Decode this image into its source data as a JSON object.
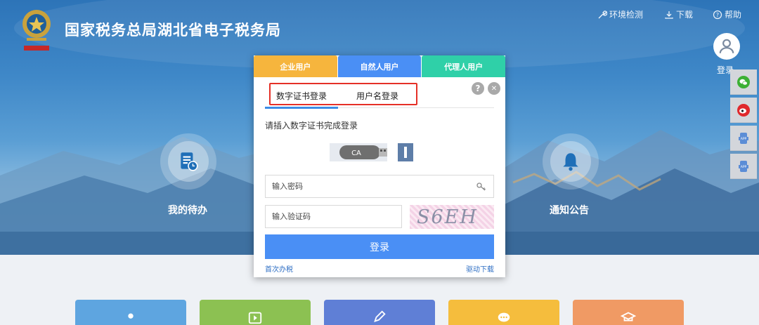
{
  "header": {
    "site_title": "国家税务总局湖北省电子税务局",
    "env_check": "环境检测",
    "download": "下载",
    "help": "帮助",
    "login": "登录"
  },
  "features": {
    "todo": "我的待办",
    "notice": "通知公告"
  },
  "dialog": {
    "user_tabs": [
      {
        "label": "企业用户",
        "color": "#f6b53d"
      },
      {
        "label": "自然人用户",
        "color": "#4a8ff5"
      },
      {
        "label": "代理人用户",
        "color": "#2fd0a8"
      }
    ],
    "login_tabs": {
      "cert": "数字证书登录",
      "username": "用户名登录"
    },
    "help_icon": "?",
    "close_icon": "✕",
    "hint": "请插入数字证书完成登录",
    "ca_label": "CA",
    "password_placeholder": "输入密码",
    "captcha_placeholder": "输入验证码",
    "captcha_text": "S6EH",
    "login_button": "登录",
    "first_time": "首次办税",
    "driver_download": "驱动下载"
  },
  "side_dock": [
    "wechat-icon",
    "weibo-icon",
    "app-icon",
    "app-icon"
  ],
  "colors": {
    "accent": "#4a8ff5",
    "highlight": "#e53027",
    "tile_colors": [
      "#5ea5e0",
      "#8cc152",
      "#5f7fd6",
      "#f5bd3d",
      "#f09a64"
    ]
  }
}
